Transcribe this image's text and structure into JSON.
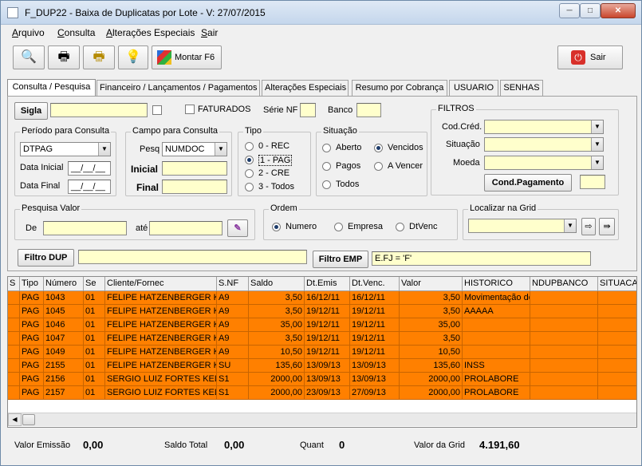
{
  "window": {
    "title": "F_DUP22 - Baixa de Duplicatas por Lote - V: 27/07/2015",
    "minimize": "─",
    "maximize": "□",
    "close": "✕"
  },
  "menu": [
    {
      "key": "A",
      "rest": "rquivo"
    },
    {
      "key": "C",
      "rest": "onsulta"
    },
    {
      "key": "A",
      "rest": "lterações Especiais"
    },
    {
      "key": "S",
      "rest": "air"
    }
  ],
  "toolbar": {
    "search_icon": "🔍",
    "print_icon": "🖶",
    "print2_icon": "🖶",
    "lamp_icon": "💡",
    "montar_label": "Montar F6",
    "sair_label": "Sair"
  },
  "tabs": [
    "Consulta / Pesquisa",
    "Financeiro / Lançamentos / Pagamentos",
    "Alterações Especiais",
    "Resumo por Cobrança",
    "USUARIO",
    "SENHAS"
  ],
  "form": {
    "sigla_label": "Sigla",
    "faturados_label": "FATURADOS",
    "serie_label": "Série NF",
    "banco_label": "Banco",
    "filtros_label": "FILTROS",
    "codcred_label": "Cod.Créd.",
    "situacao_label": "Situação",
    "moeda_label": "Moeda",
    "condpag_label": "Cond.Pagamento",
    "periodo_label": "Período para Consulta",
    "periodo_value": "DTPAG",
    "data_inicial_label": "Data Inicial",
    "data_inicial_value": "__/__/__",
    "data_final_label": "Data Final",
    "data_final_value": "__/__/__",
    "campo_label": "Campo para Consulta",
    "pesq_label": "Pesq",
    "pesq_value": "NUMDOC",
    "inicial_label": "Inicial",
    "final_label": "Final",
    "tipo_label": "Tipo",
    "tipo_options": [
      "0 - REC",
      "1 - PAG",
      "2 - CRE",
      "3 - Todos"
    ],
    "situacao_group_label": "Situação",
    "sit_aberto": "Aberto",
    "sit_vencidos": "Vencidos",
    "sit_pagos": "Pagos",
    "sit_avencer": "A Vencer",
    "sit_todos": "Todos",
    "pesqvalor_label": "Pesquisa Valor",
    "de_label": "De",
    "ate_label": "até",
    "ordem_label": "Ordem",
    "ordem_numero": "Numero",
    "ordem_empresa": "Empresa",
    "ordem_dtvenc": "DtVenc",
    "localizar_label": "Localizar na Grid",
    "filtro_dup_label": "Filtro DUP",
    "filtro_emp_label": "Filtro EMP",
    "filtro_emp_value": "E.FJ = 'F'"
  },
  "grid": {
    "headers": [
      "S",
      "Tipo",
      "Número",
      "Se",
      "Cliente/Fornec",
      "S.NF",
      "Saldo",
      "Dt.Emis",
      "Dt.Venc.",
      "Valor",
      "HISTORICO",
      "NDUPBANCO",
      "SITUACA"
    ],
    "rows": [
      [
        "",
        "PAG",
        "1043",
        "01",
        "FELIPE HATZENBERGER K",
        "A9",
        "3,50",
        "16/12/11",
        "16/12/11",
        "3,50",
        "Movimentação de",
        ""
      ],
      [
        "",
        "PAG",
        "1045",
        "01",
        "FELIPE HATZENBERGER K",
        "A9",
        "3,50",
        "19/12/11",
        "19/12/11",
        "3,50",
        "AAAAA",
        ""
      ],
      [
        "",
        "PAG",
        "1046",
        "01",
        "FELIPE HATZENBERGER K",
        "A9",
        "35,00",
        "19/12/11",
        "19/12/11",
        "35,00",
        "",
        ""
      ],
      [
        "",
        "PAG",
        "1047",
        "01",
        "FELIPE HATZENBERGER K",
        "A9",
        "3,50",
        "19/12/11",
        "19/12/11",
        "3,50",
        "",
        ""
      ],
      [
        "",
        "PAG",
        "1049",
        "01",
        "FELIPE HATZENBERGER K",
        "A9",
        "10,50",
        "19/12/11",
        "19/12/11",
        "10,50",
        "",
        ""
      ],
      [
        "",
        "PAG",
        "2155",
        "01",
        "FELIPE HATZENBERGER K",
        "SU",
        "135,60",
        "13/09/13",
        "13/09/13",
        "135,60",
        "INSS",
        ""
      ],
      [
        "",
        "PAG",
        "2156",
        "01",
        "SERGIO LUIZ FORTES KEL",
        "S1",
        "2000,00",
        "13/09/13",
        "13/09/13",
        "2000,00",
        "PROLABORE",
        ""
      ],
      [
        "",
        "PAG",
        "2157",
        "01",
        "SERGIO LUIZ FORTES KEL",
        "S1",
        "2000,00",
        "23/09/13",
        "27/09/13",
        "2000,00",
        "PROLABORE",
        ""
      ]
    ]
  },
  "footer": {
    "valor_emissao_label": "Valor Emissão",
    "valor_emissao": "0,00",
    "saldo_total_label": "Saldo Total",
    "saldo_total": "0,00",
    "quant_label": "Quant",
    "quant": "0",
    "valor_grid_label": "Valor da Grid",
    "valor_grid": "4.191,60"
  }
}
